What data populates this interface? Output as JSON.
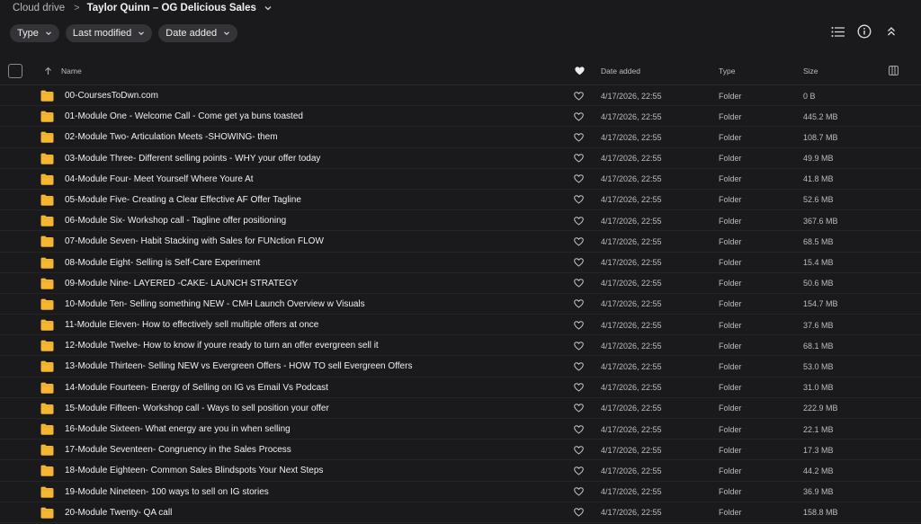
{
  "breadcrumb": {
    "root": "Cloud drive",
    "separator": ">",
    "current": "Taylor Quinn – OG Delicious Sales"
  },
  "filters": [
    {
      "label": "Type"
    },
    {
      "label": "Last modified"
    },
    {
      "label": "Date added"
    }
  ],
  "toolbar_icons": [
    "list-view-icon",
    "info-icon",
    "collapse-icon"
  ],
  "table": {
    "columns": {
      "name": "Name",
      "date_added": "Date added",
      "type": "Type",
      "size": "Size"
    },
    "rows": [
      {
        "name": "00-CoursesToDwn.com",
        "date": "4/17/2026, 22:55",
        "type": "Folder",
        "size": "0 B"
      },
      {
        "name": "01-Module One - Welcome Call - Come get ya buns toasted",
        "date": "4/17/2026, 22:55",
        "type": "Folder",
        "size": "445.2 MB"
      },
      {
        "name": "02-Module Two- Articulation Meets -SHOWING- them",
        "date": "4/17/2026, 22:55",
        "type": "Folder",
        "size": "108.7 MB"
      },
      {
        "name": "03-Module Three- Different selling points - WHY your offer today",
        "date": "4/17/2026, 22:55",
        "type": "Folder",
        "size": "49.9 MB"
      },
      {
        "name": "04-Module Four- Meet Yourself Where Youre At",
        "date": "4/17/2026, 22:55",
        "type": "Folder",
        "size": "41.8 MB"
      },
      {
        "name": "05-Module Five- Creating a Clear Effective AF Offer Tagline",
        "date": "4/17/2026, 22:55",
        "type": "Folder",
        "size": "52.6 MB"
      },
      {
        "name": "06-Module Six- Workshop call - Tagline offer positioning",
        "date": "4/17/2026, 22:55",
        "type": "Folder",
        "size": "367.6 MB"
      },
      {
        "name": "07-Module Seven- Habit Stacking with Sales for FUNction FLOW",
        "date": "4/17/2026, 22:55",
        "type": "Folder",
        "size": "68.5 MB"
      },
      {
        "name": "08-Module Eight- Selling is Self-Care Experiment",
        "date": "4/17/2026, 22:55",
        "type": "Folder",
        "size": "15.4 MB"
      },
      {
        "name": "09-Module Nine- LAYERED -CAKE- LAUNCH STRATEGY",
        "date": "4/17/2026, 22:55",
        "type": "Folder",
        "size": "50.6 MB"
      },
      {
        "name": "10-Module Ten- Selling something NEW - CMH Launch Overview w Visuals",
        "date": "4/17/2026, 22:55",
        "type": "Folder",
        "size": "154.7 MB"
      },
      {
        "name": "11-Module Eleven- How to effectively sell multiple offers at once",
        "date": "4/17/2026, 22:55",
        "type": "Folder",
        "size": "37.6 MB"
      },
      {
        "name": "12-Module Twelve- How to know if youre ready to turn an offer evergreen sell it",
        "date": "4/17/2026, 22:55",
        "type": "Folder",
        "size": "68.1 MB"
      },
      {
        "name": "13-Module Thirteen- Selling NEW vs Evergreen Offers - HOW TO sell Evergreen Offers",
        "date": "4/17/2026, 22:55",
        "type": "Folder",
        "size": "53.0 MB"
      },
      {
        "name": "14-Module Fourteen- Energy of Selling on IG vs Email Vs Podcast",
        "date": "4/17/2026, 22:55",
        "type": "Folder",
        "size": "31.0 MB"
      },
      {
        "name": "15-Module Fifteen- Workshop call - Ways to sell position your offer",
        "date": "4/17/2026, 22:55",
        "type": "Folder",
        "size": "222.9 MB"
      },
      {
        "name": "16-Module Sixteen- What energy are you in when selling",
        "date": "4/17/2026, 22:55",
        "type": "Folder",
        "size": "22.1 MB"
      },
      {
        "name": "17-Module Seventeen- Congruency in the Sales Process",
        "date": "4/17/2026, 22:55",
        "type": "Folder",
        "size": "17.3 MB"
      },
      {
        "name": "18-Module Eighteen- Common Sales Blindspots Your Next Steps",
        "date": "4/17/2026, 22:55",
        "type": "Folder",
        "size": "44.2 MB"
      },
      {
        "name": "19-Module Nineteen- 100 ways to sell on IG stories",
        "date": "4/17/2026, 22:55",
        "type": "Folder",
        "size": "36.9 MB"
      },
      {
        "name": "20-Module Twenty- QA call",
        "date": "4/17/2026, 22:55",
        "type": "Folder",
        "size": "158.8 MB"
      }
    ]
  },
  "colors": {
    "background": "#1a1a1c",
    "folder": "#f5b731",
    "chip": "#343438"
  }
}
